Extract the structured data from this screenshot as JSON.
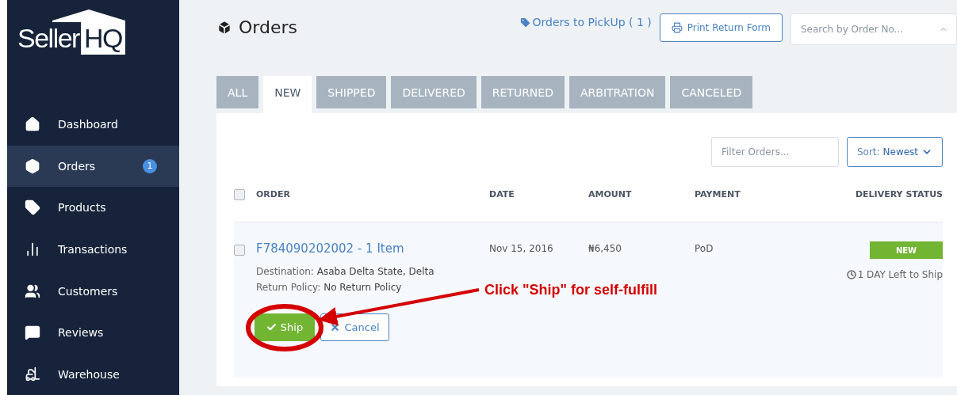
{
  "logo": {
    "text": "Seller",
    "boxed": "HQ"
  },
  "sidebar": {
    "items": [
      {
        "label": "Dashboard",
        "selected": false
      },
      {
        "label": "Orders",
        "selected": true,
        "badge": "1"
      },
      {
        "label": "Products",
        "selected": false
      },
      {
        "label": "Transactions",
        "selected": false
      },
      {
        "label": "Customers",
        "selected": false
      },
      {
        "label": "Reviews",
        "selected": false
      },
      {
        "label": "Warehouse",
        "selected": false
      }
    ]
  },
  "header": {
    "title": "Orders",
    "pickup_link": "Orders to PickUp ( 1 )",
    "print_button": "Print Return Form",
    "search": {
      "placeholder": "Search by Order No..."
    }
  },
  "tabs": [
    {
      "label": "ALL",
      "selected": false
    },
    {
      "label": "NEW",
      "selected": true
    },
    {
      "label": "SHIPPED",
      "selected": false
    },
    {
      "label": "DELIVERED",
      "selected": false
    },
    {
      "label": "RETURNED",
      "selected": false
    },
    {
      "label": "ARBITRATION",
      "selected": false
    },
    {
      "label": "CANCELED",
      "selected": false
    }
  ],
  "filter": {
    "placeholder": "Filter Orders..."
  },
  "sort": {
    "label": "Sort:",
    "value": "Newest"
  },
  "table": {
    "select_all_checked": false,
    "columns": [
      "ORDER",
      "DATE",
      "AMOUNT",
      "PAYMENT",
      "DELIVERY STATUS"
    ],
    "rows": [
      {
        "checked": false,
        "order": "F784090202002 - 1 Item",
        "date": "Nov 15, 2016",
        "amount": "₦6,450",
        "payment": "PoD",
        "status": "NEW",
        "time_left": "1 DAY Left to Ship",
        "details": [
          {
            "label": "Destination:",
            "value": "Asaba Delta State, Delta"
          },
          {
            "label": "Return Policy:",
            "value": "No Return Policy"
          }
        ],
        "actions": [
          {
            "kind": "ship",
            "label": "Ship"
          },
          {
            "kind": "cancel",
            "label": "Cancel"
          }
        ]
      }
    ]
  },
  "annotation": {
    "text": "Click \"Ship\" for self-fulfill"
  }
}
